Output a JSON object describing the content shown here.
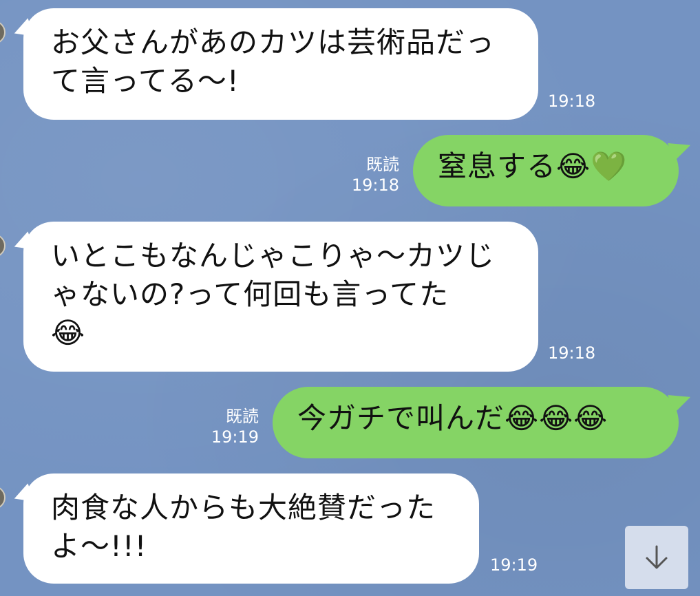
{
  "messages": [
    {
      "direction": "in",
      "text_line1": "お父さんがあのカツは芸術品だっ",
      "text_line2": "て言ってる〜!",
      "time": "19:18"
    },
    {
      "direction": "out",
      "text": "窒息する😂💚",
      "read_label": "既読",
      "time": "19:18"
    },
    {
      "direction": "in",
      "text_line1": "いとこもなんじゃこりゃ〜カツじ",
      "text_line2": "ゃないの?って何回も言ってた",
      "text_line3": "😂",
      "time": "19:18"
    },
    {
      "direction": "out",
      "text": "今ガチで叫んだ😂😂😂",
      "read_label": "既読",
      "time": "19:19"
    },
    {
      "direction": "in",
      "text_line1": "肉食な人からも大絶賛だった",
      "text_line2": "よ〜!!!",
      "time": "19:19"
    }
  ],
  "scroll_button": {
    "icon": "arrow-down-icon"
  },
  "colors": {
    "background": "#7493c2",
    "incoming_bubble": "#ffffff",
    "outgoing_bubble": "#85d465",
    "meta_text": "#ffffff"
  }
}
